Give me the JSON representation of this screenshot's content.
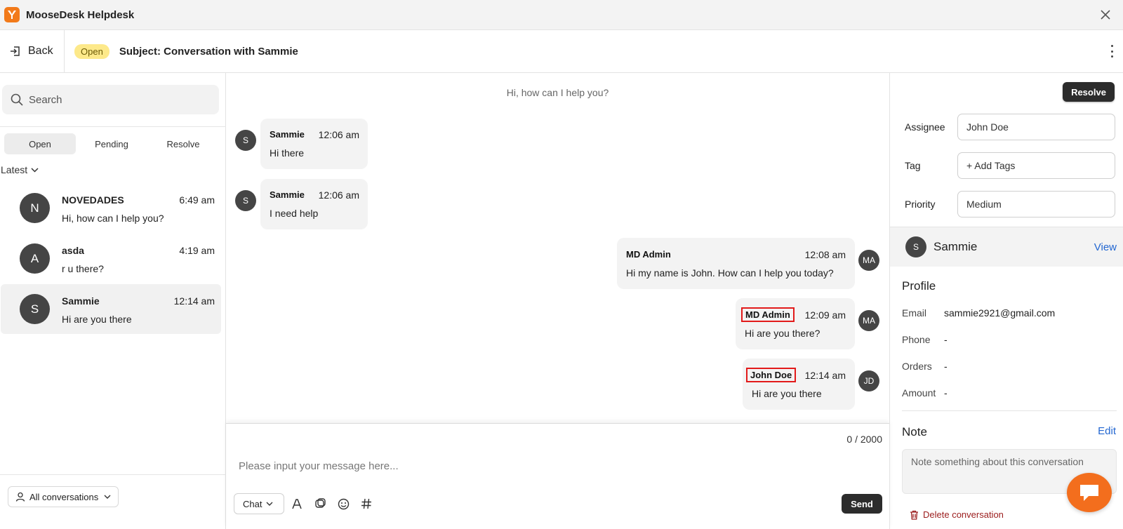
{
  "app": {
    "title": "MooseDesk Helpdesk",
    "close_icon": "close-icon",
    "logo_icon": "moose-logo-icon",
    "accent_color": "#f27a1a"
  },
  "header": {
    "back_label": "Back",
    "status": "Open",
    "subject": "Subject: Conversation with Sammie"
  },
  "left": {
    "search_placeholder": "Search",
    "tabs": [
      {
        "label": "Open",
        "active": true
      },
      {
        "label": "Pending"
      },
      {
        "label": "Resolve"
      }
    ],
    "sort_label": "Latest",
    "conversations": [
      {
        "initial": "N",
        "name": "NOVEDADES",
        "time": "6:49 am",
        "preview": "Hi, how can I help you?"
      },
      {
        "initial": "A",
        "name": "asda",
        "time": "4:19 am",
        "preview": "r u there?"
      },
      {
        "initial": "S",
        "name": "Sammie",
        "time": "12:14 am",
        "preview": "Hi are you there",
        "selected": true
      }
    ],
    "filter_label": "All conversations"
  },
  "chat": {
    "system_message": "Hi, how can I help you?",
    "messages": [
      {
        "initials": "S",
        "author": "Sammie",
        "time": "12:06 am",
        "text": "Hi there"
      },
      {
        "initials": "S",
        "author": "Sammie",
        "time": "12:06 am",
        "text": "I need help"
      },
      {
        "initials": "MA",
        "author": "MD Admin",
        "time": "12:08 am",
        "text": "Hi my name is John. How can I help you today?"
      },
      {
        "initials": "MA",
        "author": "MD Admin",
        "time": "12:09 am",
        "text": "Hi are you there?"
      },
      {
        "initials": "JD",
        "author": "John Doe",
        "time": "12:14 am",
        "text": "Hi are you there"
      }
    ],
    "composer": {
      "counter": "0 / 2000",
      "placeholder": "Please input your message here...",
      "channel": "Chat",
      "send_label": "Send"
    }
  },
  "details": {
    "resolve_label": "Resolve",
    "assignee_label": "Assignee",
    "assignee_value": "John Doe",
    "tag_label": "Tag",
    "tag_value": "+ Add Tags",
    "priority_label": "Priority",
    "priority_value": "Medium",
    "customer": {
      "initial": "S",
      "name": "Sammie",
      "view_label": "View"
    },
    "profile_title": "Profile",
    "profile": [
      {
        "label": "Email",
        "value": "sammie2921@gmail.com"
      },
      {
        "label": "Phone",
        "value": "-"
      },
      {
        "label": "Orders",
        "value": "-"
      },
      {
        "label": "Amount",
        "value": "-"
      }
    ],
    "note_title": "Note",
    "edit_label": "Edit",
    "note_placeholder": "Note something about this conversation",
    "delete_label": "Delete conversation"
  }
}
